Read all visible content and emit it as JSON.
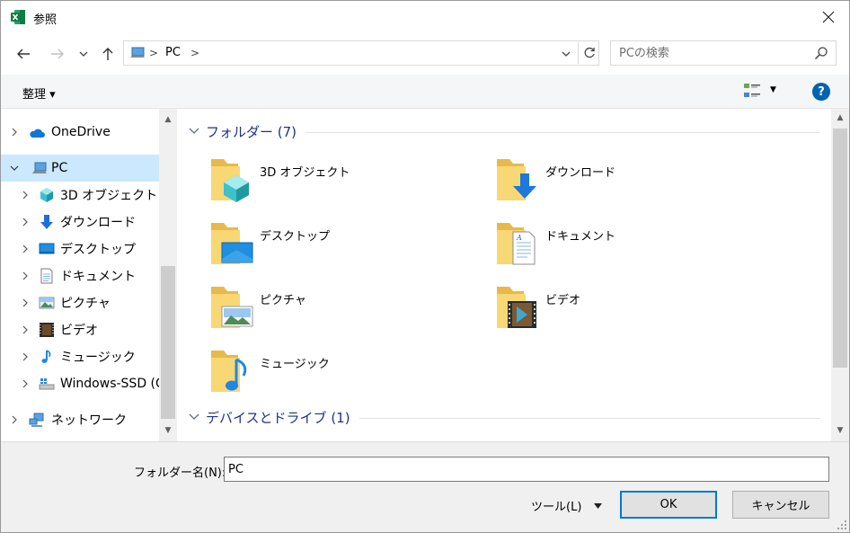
{
  "window": {
    "title": "参照",
    "app_icon": "excel-icon",
    "close_icon": "close-icon"
  },
  "address": {
    "location": "PC",
    "breadcrumb_icon": "pc-icon",
    "search_placeholder": "PCの検索"
  },
  "toolbar": {
    "organize_label": "整理 ▾",
    "help_label": "?"
  },
  "nav": {
    "items": [
      {
        "label": "OneDrive",
        "icon": "onedrive-icon"
      },
      {
        "label": "PC",
        "icon": "pc-icon",
        "selected": true
      },
      {
        "label": "3D オブジェクト",
        "icon": "3d-objects-icon"
      },
      {
        "label": "ダウンロード",
        "icon": "download-icon"
      },
      {
        "label": "デスクトップ",
        "icon": "desktop-icon"
      },
      {
        "label": "ドキュメント",
        "icon": "documents-icon"
      },
      {
        "label": "ピクチャ",
        "icon": "pictures-icon"
      },
      {
        "label": "ビデオ",
        "icon": "videos-icon"
      },
      {
        "label": "ミュージック",
        "icon": "music-icon"
      },
      {
        "label": "Windows-SSD (C",
        "icon": "drive-icon"
      },
      {
        "label": "ネットワーク",
        "icon": "network-icon"
      }
    ]
  },
  "content": {
    "folders_header": "フォルダー (7)",
    "devices_header": "デバイスとドライブ (1)",
    "folders": [
      {
        "label": "3D オブジェクト",
        "icon": "3d-objects-folder-icon"
      },
      {
        "label": "ダウンロード",
        "icon": "download-folder-icon"
      },
      {
        "label": "デスクトップ",
        "icon": "desktop-folder-icon"
      },
      {
        "label": "ドキュメント",
        "icon": "documents-folder-icon"
      },
      {
        "label": "ピクチャ",
        "icon": "pictures-folder-icon"
      },
      {
        "label": "ビデオ",
        "icon": "videos-folder-icon"
      },
      {
        "label": "ミュージック",
        "icon": "music-folder-icon"
      }
    ]
  },
  "footer": {
    "folder_name_label": "フォルダー名(N):",
    "folder_name_value": "PC",
    "tools_label": "ツール(L)",
    "ok_label": "OK",
    "cancel_label": "キャンセル"
  },
  "colors": {
    "accent": "#0078d7",
    "selected_bg": "#cce8ff",
    "group_title": "#1e3287",
    "folder_yellow": "#f8d775"
  }
}
